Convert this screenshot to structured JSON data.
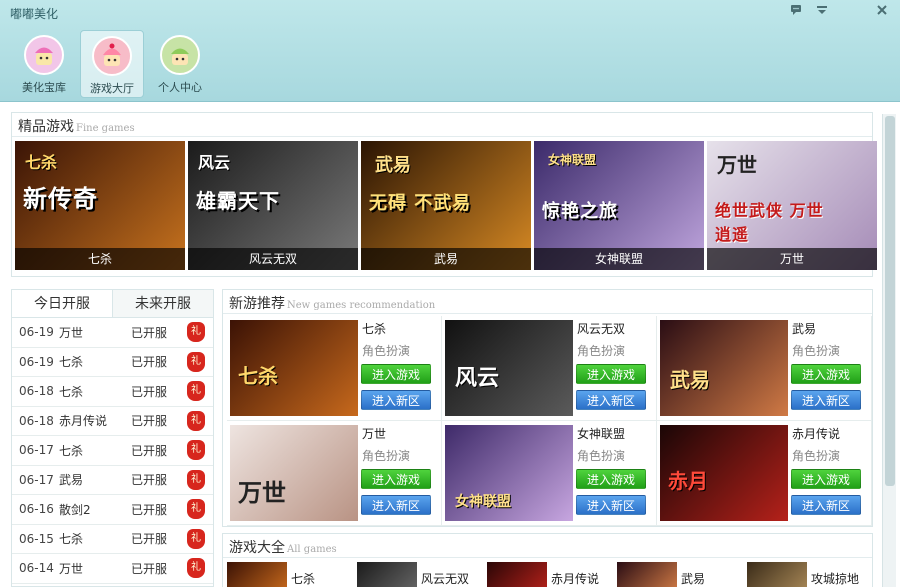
{
  "app": {
    "title": "嘟嘟美化"
  },
  "nav": [
    {
      "label": "美化宝库",
      "icon": "cupcake-icon",
      "color": "#f2c6e8"
    },
    {
      "label": "游戏大厅",
      "icon": "cake-icon",
      "color": "#f7bcc8"
    },
    {
      "label": "个人中心",
      "icon": "pudding-icon",
      "color": "#c7e3a6"
    }
  ],
  "fine_games": {
    "title": "精品游戏",
    "subtitle": "Fine games",
    "items": [
      {
        "name": "七杀",
        "art": "新传奇",
        "tag": "七杀",
        "bg": [
          "#3a1406",
          "#c8731e"
        ]
      },
      {
        "name": "风云无双",
        "art": "雄霸天下",
        "tag": "风云",
        "bg": [
          "#1b1b1b",
          "#7a7a7a"
        ]
      },
      {
        "name": "武易",
        "art": "无碍 不武易",
        "tag": "武易",
        "bg": [
          "#2a1403",
          "#d98b24"
        ]
      },
      {
        "name": "女神联盟",
        "art": "惊艳之旅",
        "tag": "女神联盟",
        "bg": [
          "#3b2a6a",
          "#c0a6de"
        ]
      },
      {
        "name": "万世",
        "art": "绝世武侠 万世逍遥",
        "tag": "万世",
        "bg": [
          "#e6e1ea",
          "#a58bb7"
        ]
      }
    ]
  },
  "servers": {
    "tabs": [
      "今日开服",
      "未来开服"
    ],
    "rows": [
      {
        "date": "06-19",
        "game": "万世",
        "status": "已开服"
      },
      {
        "date": "06-19",
        "game": "七杀",
        "status": "已开服"
      },
      {
        "date": "06-18",
        "game": "七杀",
        "status": "已开服"
      },
      {
        "date": "06-18",
        "game": "赤月传说",
        "status": "已开服"
      },
      {
        "date": "06-17",
        "game": "七杀",
        "status": "已开服"
      },
      {
        "date": "06-17",
        "game": "武易",
        "status": "已开服"
      },
      {
        "date": "06-16",
        "game": "散剑2",
        "status": "已开服"
      },
      {
        "date": "06-15",
        "game": "七杀",
        "status": "已开服"
      },
      {
        "date": "06-14",
        "game": "万世",
        "status": "已开服"
      }
    ],
    "gift_label": "礼"
  },
  "new_games": {
    "title": "新游推荐",
    "subtitle": "New games recommendation",
    "play_label": "进入游戏",
    "zone_label": "进入新区",
    "items": [
      {
        "name": "七杀",
        "genre": "角色扮演",
        "tag": "七杀",
        "bg": [
          "#3b1205",
          "#c7691c"
        ]
      },
      {
        "name": "风云无双",
        "genre": "角色扮演",
        "tag": "风云",
        "bg": [
          "#111111",
          "#5b5b5b"
        ]
      },
      {
        "name": "武易",
        "genre": "角色扮演",
        "tag": "武易",
        "bg": [
          "#2a0d14",
          "#d07a45"
        ]
      },
      {
        "name": "万世",
        "genre": "角色扮演",
        "tag": "万世",
        "bg": [
          "#eee4e0",
          "#b99384"
        ]
      },
      {
        "name": "女神联盟",
        "genre": "角色扮演",
        "tag": "女神联盟",
        "bg": [
          "#3e2a69",
          "#c7a6e0"
        ]
      },
      {
        "name": "赤月传说",
        "genre": "角色扮演",
        "tag": "赤月",
        "bg": [
          "#1a0606",
          "#b5211a"
        ]
      }
    ]
  },
  "all_games": {
    "title": "游戏大全",
    "subtitle": "All games",
    "items": [
      {
        "name": "七杀",
        "bg": [
          "#3b1205",
          "#c7691c"
        ]
      },
      {
        "name": "风云无双",
        "bg": [
          "#1b1b1b",
          "#666666"
        ]
      },
      {
        "name": "赤月传说",
        "bg": [
          "#2a0606",
          "#b5211a"
        ]
      },
      {
        "name": "武易",
        "bg": [
          "#2a0d14",
          "#d07a45"
        ]
      },
      {
        "name": "攻城掠地",
        "bg": [
          "#3a2b18",
          "#a88857"
        ]
      }
    ]
  }
}
